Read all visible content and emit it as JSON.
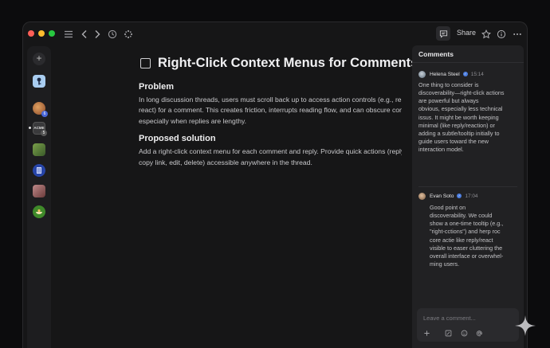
{
  "toolbar": {
    "share_label": "Share"
  },
  "rail": {
    "add_symbol": "+",
    "items": [
      {
        "name": "workspace-key",
        "color": "#a9cdf0"
      },
      {
        "name": "workspace-avatar-1",
        "color": "#c07a3a",
        "badge": "6"
      },
      {
        "name": "workspace-acme",
        "color": "#3a3a3c",
        "label": "ACME",
        "badge": "5"
      },
      {
        "name": "workspace-avatar-2",
        "color": "#5f8a3a"
      },
      {
        "name": "workspace-book",
        "color": "#2745a8"
      },
      {
        "name": "workspace-avatar-3",
        "color": "#9a6060"
      },
      {
        "name": "workspace-avatar-4",
        "color": "#3f8a2a"
      }
    ]
  },
  "document": {
    "title": "Right-Click Context Menus for Comments",
    "sections": [
      {
        "heading": "Problem",
        "lines": [
          "In long discussion threads, users must scroll back up to access action controls (e.g., reply,",
          "react) for a comment. This creates friction, interrupts reading flow, and can obscure context,",
          "especially when replies are lengthy."
        ]
      },
      {
        "heading": "Proposed solution",
        "lines": [
          "Add a right-click context menu for each comment and reply. Provide quick actions (reply, react,",
          "copy link, edit, delete) accessible anywhere in the thread."
        ]
      }
    ]
  },
  "comments_panel": {
    "title": "Comments",
    "comments": [
      {
        "author": "Helena Steel",
        "time": "15:14",
        "avatar_color": "#8a9aa8",
        "lines": [
          "One thing to consider is",
          "discoverability—right-click actions",
          "are powerful but always",
          "obvious, especially  less technical",
          "issus. It might be worth keeping",
          "minimal  (like reply/reaction) or",
          "adding a subtle/tooltip initially to",
          "guide users toward the new",
          "interaction model."
        ]
      },
      {
        "author": "Evan Soto",
        "time": "17:04",
        "avatar_color": "#b08a6a",
        "lines": [
          "Good point on",
          "discoverability. We could",
          "show a one-time tooltip (e.g.,",
          "\"right-cctions\") and herp roc",
          "core actie like reply/react",
          "visible to easer cluttering the",
          "overall interface or overwhel-",
          "ming users."
        ]
      }
    ],
    "composer_placeholder": "Leave a comment..."
  },
  "colors": {
    "accent_blue": "#4c7ee0",
    "close": "#ff5f57",
    "minimize": "#febc2e",
    "zoom": "#28c840"
  }
}
